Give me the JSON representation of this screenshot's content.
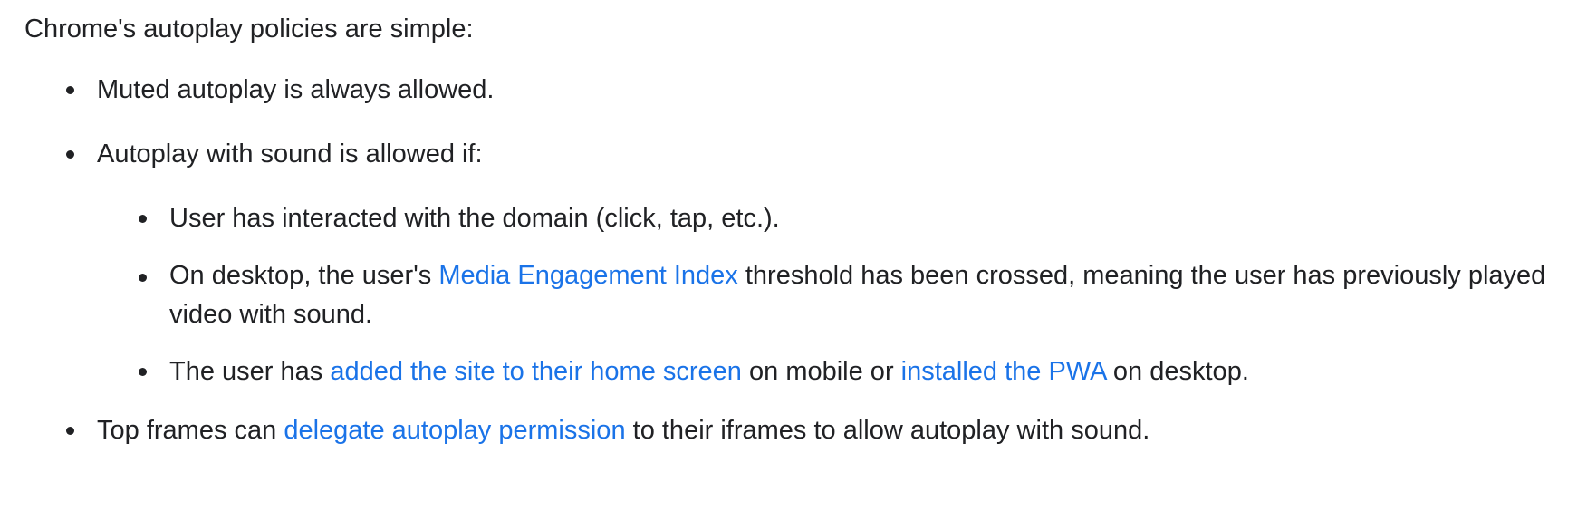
{
  "intro": "Chrome's autoplay policies are simple:",
  "items": [
    {
      "text": "Muted autoplay is always allowed."
    },
    {
      "text": "Autoplay with sound is allowed if:"
    }
  ],
  "subitems": {
    "interacted": "User has interacted with the domain (click, tap, etc.).",
    "mei": {
      "before": "On desktop, the user's ",
      "link": "Media Engagement Index",
      "after": " threshold has been crossed, meaning the user has previously played video with sound."
    },
    "homescreen": {
      "before": "The user has ",
      "link1": "added the site to their home screen",
      "middle": " on mobile or ",
      "link2": "installed the PWA",
      "after": " on desktop."
    }
  },
  "last_item": {
    "before": "Top frames can ",
    "link": "delegate autoplay permission",
    "after": " to their iframes to allow autoplay with sound."
  },
  "colors": {
    "text": "#202124",
    "link": "#1a73e8"
  }
}
